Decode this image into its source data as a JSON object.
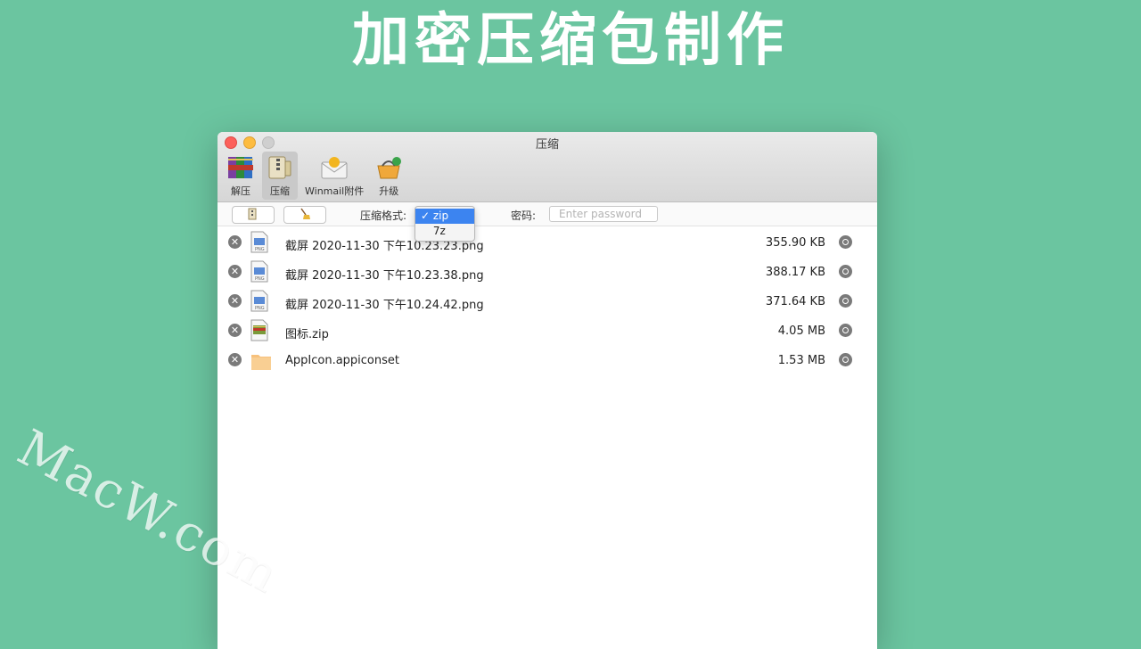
{
  "headline": "加密压缩包制作",
  "watermark": "MacW.com",
  "window": {
    "title": "压缩"
  },
  "toolbar": {
    "items": [
      {
        "label": "解压",
        "icon": "unpack-books-icon"
      },
      {
        "label": "压缩",
        "icon": "compress-zipper-icon"
      },
      {
        "label": "Winmail附件",
        "icon": "winmail-envelope-icon"
      },
      {
        "label": "升级",
        "icon": "upgrade-basket-icon"
      }
    ]
  },
  "options": {
    "format_label": "压缩格式:",
    "format_options": [
      "zip",
      "7z"
    ],
    "format_selected": "zip",
    "password_label": "密码:",
    "password_placeholder": "Enter password"
  },
  "files": [
    {
      "name": "截屏 2020-11-30 下午10.23.23.png",
      "size": "355.90 KB",
      "type": "png"
    },
    {
      "name": "截屏 2020-11-30 下午10.23.38.png",
      "size": "388.17 KB",
      "type": "png"
    },
    {
      "name": "截屏 2020-11-30 下午10.24.42.png",
      "size": "371.64 KB",
      "type": "png"
    },
    {
      "name": "图标.zip",
      "size": "4.05 MB",
      "type": "zip"
    },
    {
      "name": "AppIcon.appiconset",
      "size": "1.53 MB",
      "type": "folder"
    }
  ],
  "colors": {
    "background": "#6bc5a0",
    "selection": "#3c84f0"
  }
}
